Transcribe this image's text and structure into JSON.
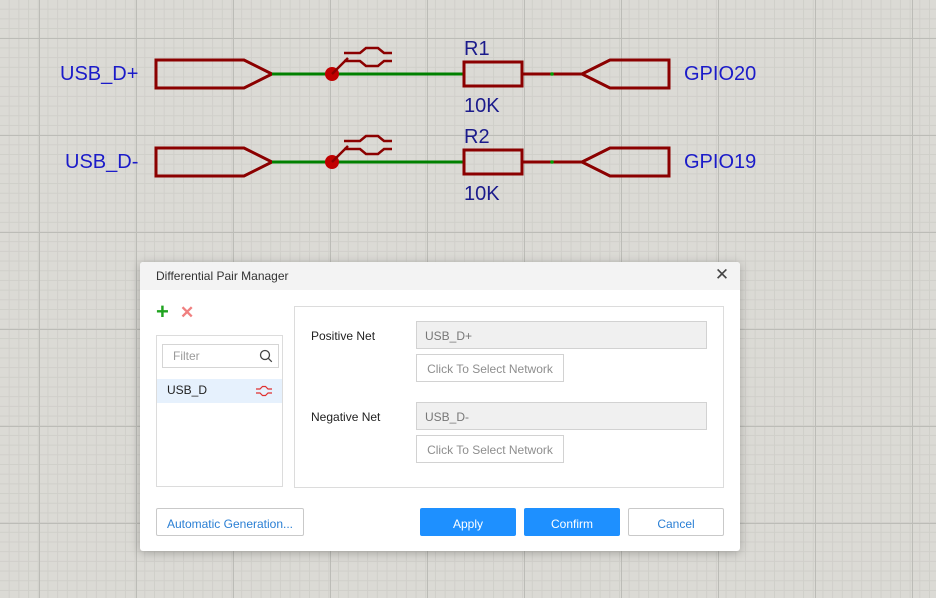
{
  "schematic": {
    "nets": [
      {
        "left_label": "USB_D+",
        "ref": "R1",
        "value": "10K",
        "right_label": "GPIO20"
      },
      {
        "left_label": "USB_D-",
        "ref": "R2",
        "value": "10K",
        "right_label": "GPIO19"
      }
    ],
    "colors": {
      "wire": "#008000",
      "component": "#8b0000",
      "junction": "#c00000",
      "text": "#1b1bc9"
    }
  },
  "dialog": {
    "title": "Differential Pair Manager",
    "close_symbol": "✕",
    "add_symbol": "+",
    "delete_symbol": "✕",
    "filter_placeholder": "Filter",
    "pairs": [
      {
        "name": "USB_D"
      }
    ],
    "positive_net_label": "Positive Net",
    "positive_net_value": "USB_D+",
    "negative_net_label": "Negative Net",
    "negative_net_value": "USB_D-",
    "select_network_label": "Click To Select Network",
    "auto_generation_label": "Automatic Generation...",
    "apply_label": "Apply",
    "confirm_label": "Confirm",
    "cancel_label": "Cancel",
    "colors": {
      "primary": "#1e90ff",
      "add": "#1fa31f",
      "delete": "#f08080"
    }
  }
}
